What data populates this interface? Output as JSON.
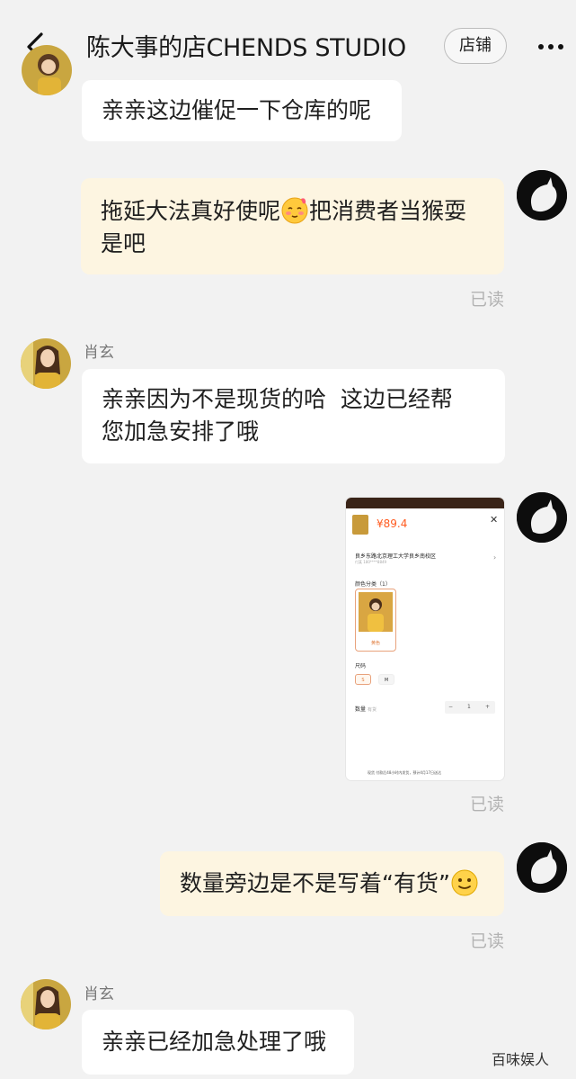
{
  "header": {
    "title": "陈大事的店CHENDS STUDIO",
    "shop_button": "店铺",
    "back_icon": "chevron-left-icon",
    "more_icon": "more-dots-icon"
  },
  "messages": [
    {
      "side": "in",
      "text": "亲亲这边催促一下仓库的呢"
    },
    {
      "side": "out",
      "text_line1_a": "拖延大法真好使呢",
      "text_line1_b": "把消费者当猴耍",
      "text_line2": "是吧",
      "emoji": "blushing-face-icon",
      "status": "已读"
    },
    {
      "side": "in",
      "sender": "肖玄",
      "text_line1": "亲亲因为不是现货的哈  这边已经帮",
      "text_line2": "您加急安排了哦"
    },
    {
      "side": "out",
      "type": "image",
      "status": "已读",
      "image": {
        "price": "¥89.4",
        "address": "良乡东路北京理工大学良乡南校区",
        "address_sub": "付某 180****8849",
        "color_label": "颜色分类（1）",
        "color_option": "黄色",
        "size_label": "尺码",
        "sizes": [
          "S",
          "M"
        ],
        "quantity_label": "数量",
        "quantity_note": "有货",
        "quantity": "1",
        "footer": "现货 付款后48小时内发货，预计4月17日送达"
      }
    },
    {
      "side": "out",
      "text": "数量旁边是不是写着“有货”",
      "emoji": "slight-smile-icon",
      "status": "已读"
    },
    {
      "side": "in",
      "sender": "肖玄",
      "text": "亲亲已经加急处理了哦"
    }
  ],
  "watermark": "百味娱人",
  "colors": {
    "background": "#f2f2f2",
    "incoming_bubble": "#ffffff",
    "outgoing_bubble": "#fdf5e1",
    "read_text": "#b3b3b3",
    "price_accent": "#ff5a1f"
  }
}
